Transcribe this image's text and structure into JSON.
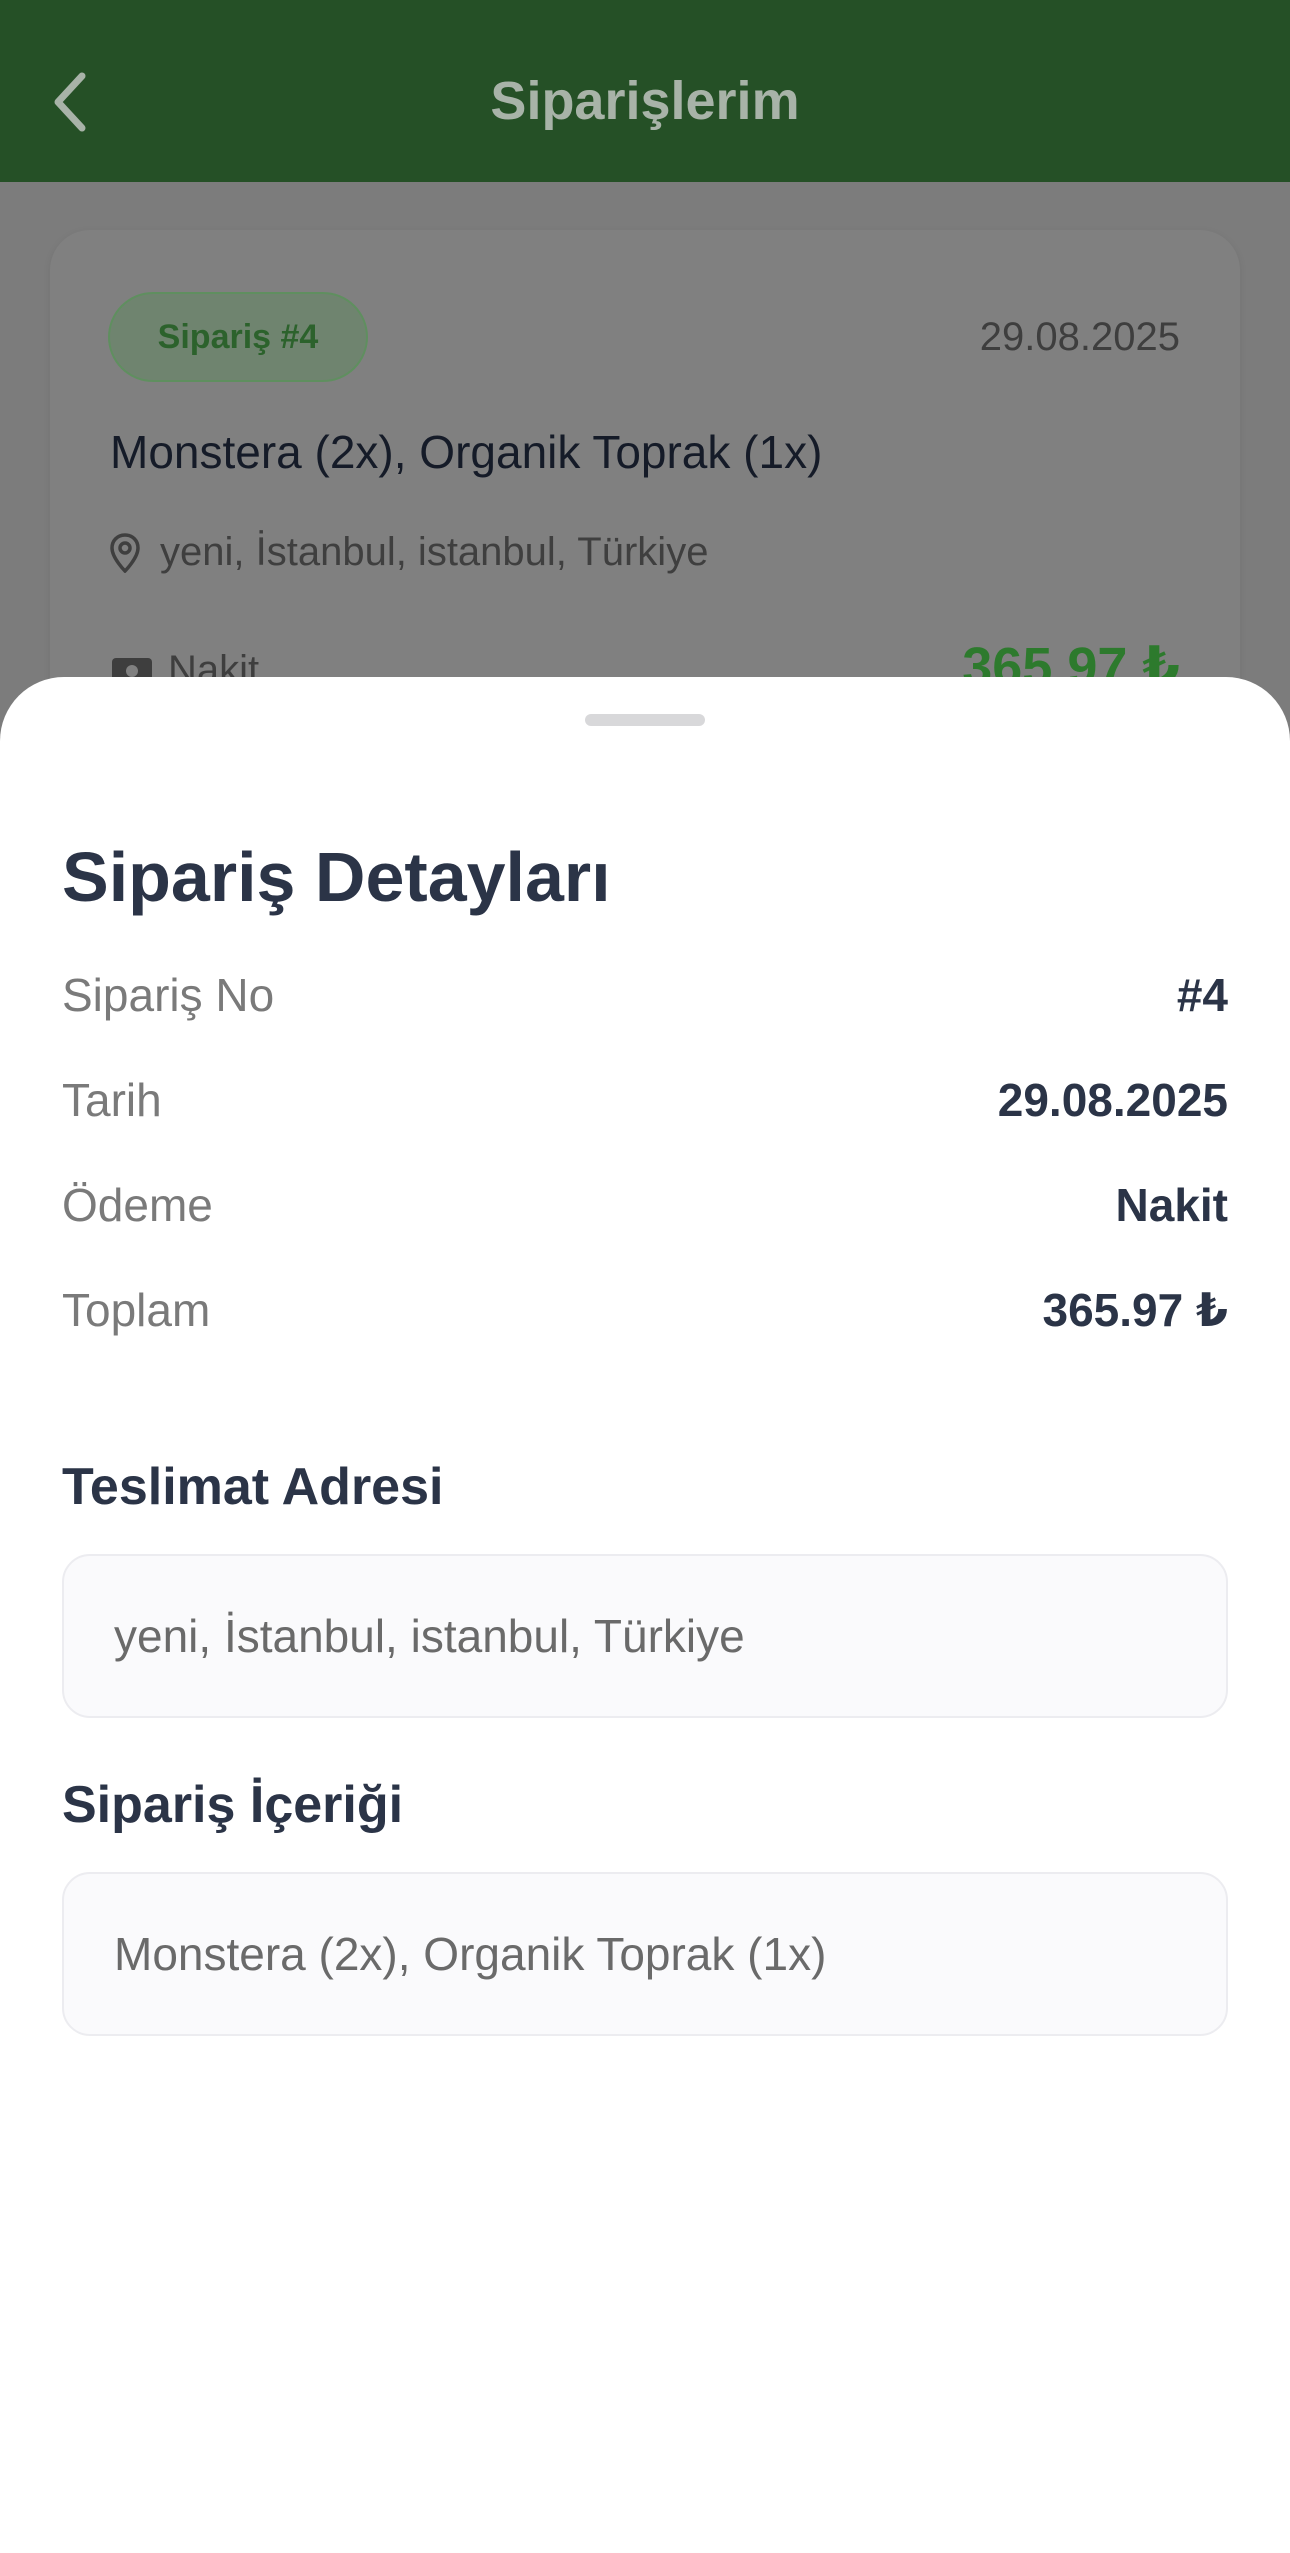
{
  "header": {
    "title": "Siparişlerim",
    "back_icon": "chevron-left-icon",
    "background_color": "#255026"
  },
  "order_card": {
    "badge": "Sipariş #4",
    "date": "29.08.2025",
    "items": "Monstera (2x), Organik Toprak (1x)",
    "address": "yeni, İstanbul, istanbul, Türkiye",
    "payment": "Nakit",
    "total": "365.97 ₺",
    "accent_color": "#2d7a2d"
  },
  "sheet": {
    "title": "Sipariş Detayları",
    "details": [
      {
        "label": "Sipariş No",
        "value": "#4"
      },
      {
        "label": "Tarih",
        "value": "29.08.2025"
      },
      {
        "label": "Ödeme",
        "value": "Nakit"
      },
      {
        "label": "Toplam",
        "value": "365.97 ₺"
      }
    ],
    "address_title": "Teslimat Adresi",
    "address": "yeni, İstanbul, istanbul, Türkiye",
    "contents_title": "Sipariş İçeriği",
    "contents": "Monstera (2x), Organik Toprak (1x)",
    "text_color": "#2b3447"
  }
}
